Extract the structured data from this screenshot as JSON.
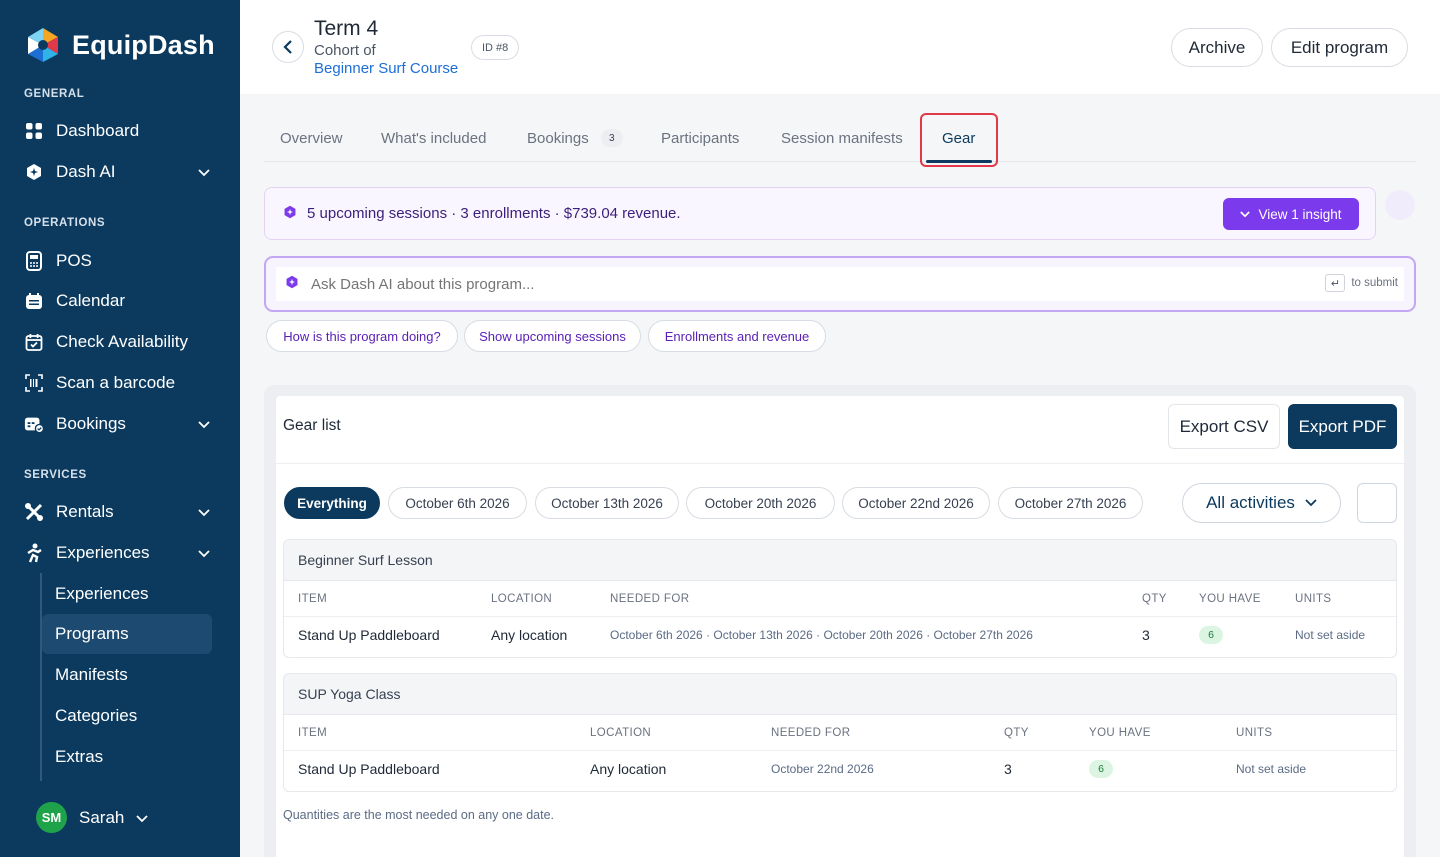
{
  "brand": {
    "name": "EquipDash"
  },
  "sidebar": {
    "sections": {
      "general": "GENERAL",
      "operations": "OPERATIONS",
      "services": "SERVICES"
    },
    "general": [
      {
        "label": "Dashboard",
        "icon": "grid-icon"
      },
      {
        "label": "Dash AI",
        "icon": "ai-hexagon-icon"
      }
    ],
    "operations": [
      {
        "label": "POS",
        "icon": "pos-icon"
      },
      {
        "label": "Calendar",
        "icon": "calendar-icon"
      },
      {
        "label": "Check Availability",
        "icon": "calendar-check-icon"
      },
      {
        "label": "Scan a barcode",
        "icon": "barcode-icon"
      },
      {
        "label": "Bookings",
        "icon": "bookings-icon"
      }
    ],
    "services": [
      {
        "label": "Rentals",
        "icon": "rentals-icon"
      },
      {
        "label": "Experiences",
        "icon": "experiences-icon"
      }
    ],
    "experiences_sub": [
      "Experiences",
      "Programs",
      "Manifests",
      "Categories",
      "Extras"
    ],
    "user": {
      "initials": "SM",
      "name": "Sarah"
    }
  },
  "header": {
    "title": "Term 4",
    "cohort_label": "Cohort of",
    "course_link": "Beginner Surf Course",
    "id_badge": "ID #8",
    "archive_label": "Archive",
    "edit_label": "Edit program"
  },
  "tabs": [
    {
      "label": "Overview"
    },
    {
      "label": "What's included"
    },
    {
      "label": "Bookings",
      "count": "3"
    },
    {
      "label": "Participants"
    },
    {
      "label": "Session manifests"
    },
    {
      "label": "Gear",
      "active": true
    }
  ],
  "insight": {
    "text": "5 upcoming sessions · 3 enrollments · $739.04 revenue.",
    "button": "View 1 insight"
  },
  "ask": {
    "placeholder": "Ask Dash AI about this program...",
    "hint": "to submit",
    "chips": [
      "How is this program doing?",
      "Show upcoming sessions",
      "Enrollments and revenue"
    ]
  },
  "gear": {
    "title": "Gear list",
    "export_csv": "Export CSV",
    "export_pdf": "Export PDF",
    "dates": [
      "Everything",
      "October 6th 2026",
      "October 13th 2026",
      "October 20th 2026",
      "October 22nd 2026",
      "October 27th 2026"
    ],
    "activities_label": "All activities",
    "groups": [
      {
        "name": "Beginner Surf Lesson",
        "headers": [
          "ITEM",
          "LOCATION",
          "NEEDED FOR",
          "QTY",
          "YOU HAVE",
          "UNITS"
        ],
        "rows": [
          {
            "item": "Stand Up Paddleboard",
            "location": "Any location",
            "needed_for": "October 6th 2026 · October 13th 2026 · October 20th 2026 · October 27th 2026",
            "qty": "3",
            "you_have": "6",
            "units": "Not set aside"
          }
        ]
      },
      {
        "name": "SUP Yoga Class",
        "headers": [
          "ITEM",
          "LOCATION",
          "NEEDED FOR",
          "QTY",
          "YOU HAVE",
          "UNITS"
        ],
        "rows": [
          {
            "item": "Stand Up Paddleboard",
            "location": "Any location",
            "needed_for": "October 22nd 2026",
            "qty": "3",
            "you_have": "6",
            "units": "Not set aside"
          }
        ]
      }
    ],
    "footnote": "Quantities are the most needed on any one date."
  },
  "colors": {
    "sidebar": "#0b3a5e",
    "accent_purple": "#7c3aed",
    "link_blue": "#1d6fd6",
    "highlight_red": "#e0394a"
  }
}
